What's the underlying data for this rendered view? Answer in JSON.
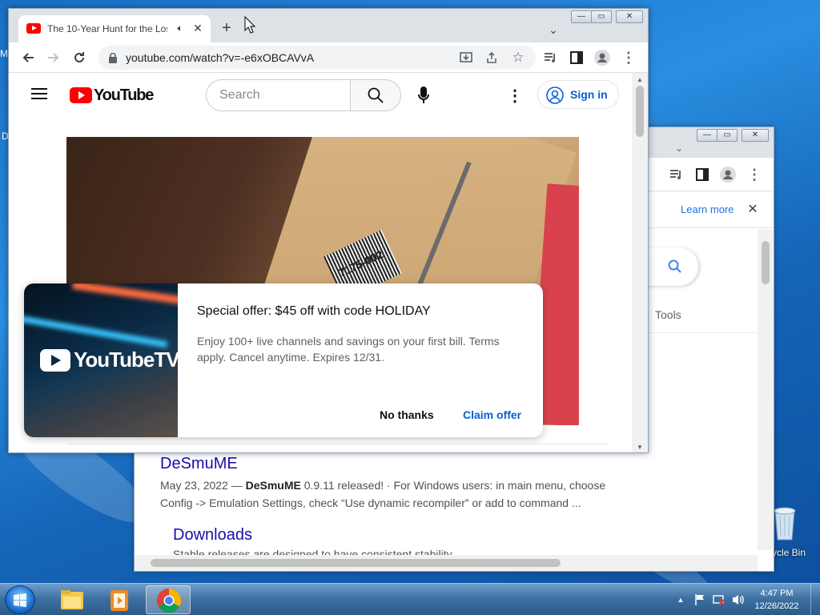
{
  "desktop": {
    "recycle_bin_label": "ycle Bin"
  },
  "back_window": {
    "learn_more": "Learn more",
    "tools": "Tools",
    "results": [
      {
        "title": "DeSmuME",
        "date": "May 23, 2022 —",
        "bold": "DeSmuME",
        "snippet_rest": "0.9.11 released! · For Windows users: in main menu, choose",
        "snippet_line2": "Config -> Emulation Settings, check “Use dynamic recompiler” or add to command ..."
      },
      {
        "title": "Downloads",
        "snippet": "Stable releases are designed to have consistent stability"
      }
    ]
  },
  "front_window": {
    "tab_title": "The 10-Year Hunt for the Los",
    "url": "youtube.com/watch?v=-e6xOBCAVvA",
    "youtube": {
      "logo_text": "YouTube",
      "search_placeholder": "Search",
      "sign_in": "Sign in"
    },
    "video": {
      "label_code": "7175-002"
    }
  },
  "promo": {
    "logo_text": "YouTubeTV",
    "title": "Special offer: $45 off with code HOLIDAY",
    "body": "Enjoy 100+ live channels and savings on your first bill. Terms apply. Cancel anytime. Expires 12/31.",
    "no_thanks": "No thanks",
    "claim_offer": "Claim offer"
  },
  "taskbar": {
    "time": "4:47 PM",
    "date": "12/26/2022"
  },
  "colors": {
    "youtube_red": "#ff0000",
    "link_blue": "#065fd4",
    "serp_title": "#1a0dab"
  }
}
